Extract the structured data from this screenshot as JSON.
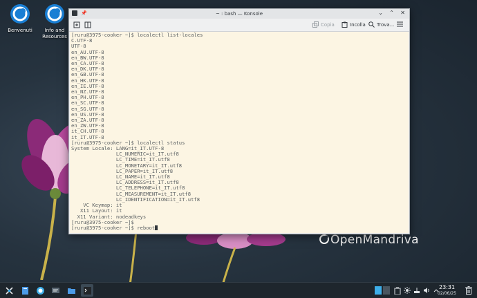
{
  "desktop": {
    "icons": [
      {
        "label": "Benvenuti"
      },
      {
        "label": "Info and Resources"
      }
    ],
    "brand": "OpenMandriva"
  },
  "window": {
    "title": "~ : bash — Konsole",
    "toolbar": {
      "copy": "Copia",
      "paste": "Incolla",
      "find": "Trova..."
    }
  },
  "terminal": {
    "lines": [
      "[ruru@3975-cooker ~]$ localectl list-locales",
      "C.UTF-8",
      "UTF-8",
      "en_AU.UTF-8",
      "en_BW.UTF-8",
      "en_CA.UTF-8",
      "en_DK.UTF-8",
      "en_GB.UTF-8",
      "en_HK.UTF-8",
      "en_IE.UTF-8",
      "en_NZ.UTF-8",
      "en_PH.UTF-8",
      "en_SC.UTF-8",
      "en_SG.UTF-8",
      "en_US.UTF-8",
      "en_ZA.UTF-8",
      "en_ZW.UTF-8",
      "it_CH.UTF-8",
      "it_IT.UTF-8",
      "[ruru@3975-cooker ~]$ localectl status",
      "System Locale: LANG=it_IT.UTF-8",
      "               LC_NUMERIC=it_IT.utf8",
      "               LC_TIME=it_IT.utf8",
      "               LC_MONETARY=it_IT.utf8",
      "               LC_PAPER=it_IT.utf8",
      "               LC_NAME=it_IT.utf8",
      "               LC_ADDRESS=it_IT.utf8",
      "               LC_TELEPHONE=it_IT.utf8",
      "               LC_MEASUREMENT=it_IT.utf8",
      "               LC_IDENTIFICATION=it_IT.utf8",
      "    VC Keymap: it",
      "   X11 Layout: it",
      "  X11 Variant: nodeadkeys",
      "[ruru@3975-cooker ~]$",
      "[ruru@3975-cooker ~]$ reboot"
    ]
  },
  "taskbar": {
    "time": "23:31",
    "date": "02/06/25"
  },
  "colors": {
    "terminal_bg": "#fcf5e3",
    "terminal_fg": "#5a5f62",
    "taskbar_bg": "#1e262d"
  }
}
